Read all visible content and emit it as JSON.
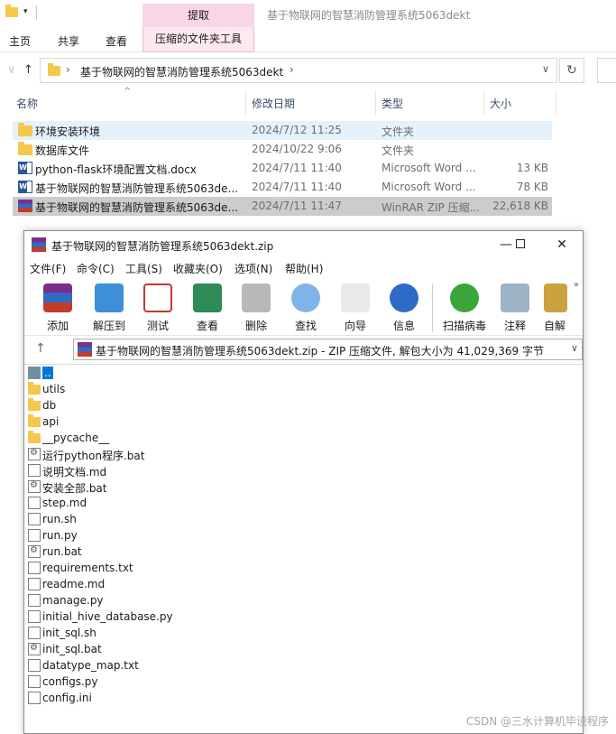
{
  "explorer": {
    "quick_access_dropdown": "▾",
    "extract_tab": "提取",
    "window_title": "基于物联网的智慧消防管理系统5063dekt",
    "ribbon_tabs": [
      "主页",
      "共享",
      "查看"
    ],
    "ribbon_tool_tab": "压缩的文件夹工具",
    "nav_back": "←",
    "nav_forward": "→",
    "nav_recent": "∨",
    "nav_up": "↑",
    "address": "基于物联网的智慧消防管理系统5063dekt",
    "columns": [
      "名称",
      "修改日期",
      "类型",
      "大小"
    ],
    "files": [
      {
        "name": "环境安装环境",
        "date": "2024/7/12 11:25",
        "type": "文件夹",
        "size": ""
      },
      {
        "name": "数据库文件",
        "date": "2024/10/22 9:06",
        "type": "文件夹",
        "size": ""
      },
      {
        "name": "python-flask环境配置文档.docx",
        "date": "2024/7/11 11:40",
        "type": "Microsoft Word ...",
        "size": "13 KB"
      },
      {
        "name": "基于物联网的智慧消防管理系统5063de...",
        "date": "2024/7/11 11:40",
        "type": "Microsoft Word ...",
        "size": "78 KB"
      },
      {
        "name": "基于物联网的智慧消防管理系统5063de...",
        "date": "2024/7/11 11:47",
        "type": "WinRAR ZIP 压缩...",
        "size": "22,618 KB"
      }
    ]
  },
  "winrar": {
    "title": "基于物联网的智慧消防管理系统5063dekt.zip",
    "menu": [
      "文件(F)",
      "命令(C)",
      "工具(S)",
      "收藏夹(O)",
      "选项(N)",
      "帮助(H)"
    ],
    "toolbar": [
      {
        "label": "添加",
        "icon": "add-archive-icon",
        "color": "#c0392b"
      },
      {
        "label": "解压到",
        "icon": "extract-folder-icon",
        "color": "#3d8fd8"
      },
      {
        "label": "测试",
        "icon": "test-clipboard-icon",
        "color": "#c0392b"
      },
      {
        "label": "查看",
        "icon": "view-book-icon",
        "color": "#2e8b57"
      },
      {
        "label": "删除",
        "icon": "delete-bin-icon",
        "color": "#8c8c8c"
      },
      {
        "label": "查找",
        "icon": "find-magnifier-icon",
        "color": "#3d7fc8"
      },
      {
        "label": "向导",
        "icon": "wizard-wand-icon",
        "color": "#7a7a7a"
      },
      {
        "label": "信息",
        "icon": "info-icon",
        "color": "#2e6bc6"
      },
      {
        "label": "扫描病毒",
        "icon": "virus-scan-icon",
        "color": "#3aa63a"
      },
      {
        "label": "注释",
        "icon": "comment-icon",
        "color": "#7a95b0"
      },
      {
        "label": "自解",
        "icon": "sfx-box-icon",
        "color": "#c9a23d"
      }
    ],
    "toolbar_more": "»",
    "path_up": "↑",
    "path_text": "基于物联网的智慧消防管理系统5063dekt.zip - ZIP 压缩文件, 解包大小为 41,029,369 字节",
    "path_dropdown": "∨",
    "items": [
      {
        "name": "..",
        "kind": "up"
      },
      {
        "name": "utils",
        "kind": "folder"
      },
      {
        "name": "db",
        "kind": "folder"
      },
      {
        "name": "api",
        "kind": "folder"
      },
      {
        "name": "__pycache__",
        "kind": "folder"
      },
      {
        "name": "运行python程序.bat",
        "kind": "bat"
      },
      {
        "name": "说明文档.md",
        "kind": "file"
      },
      {
        "name": "安装全部.bat",
        "kind": "bat"
      },
      {
        "name": "step.md",
        "kind": "file"
      },
      {
        "name": "run.sh",
        "kind": "file"
      },
      {
        "name": "run.py",
        "kind": "file"
      },
      {
        "name": "run.bat",
        "kind": "bat"
      },
      {
        "name": "requirements.txt",
        "kind": "file"
      },
      {
        "name": "readme.md",
        "kind": "file"
      },
      {
        "name": "manage.py",
        "kind": "file"
      },
      {
        "name": "initial_hive_database.py",
        "kind": "file"
      },
      {
        "name": "init_sql.sh",
        "kind": "file"
      },
      {
        "name": "init_sql.bat",
        "kind": "bat"
      },
      {
        "name": "datatype_map.txt",
        "kind": "file"
      },
      {
        "name": "configs.py",
        "kind": "file"
      },
      {
        "name": "config.ini",
        "kind": "file"
      }
    ]
  },
  "watermark": "CSDN @三水计算机毕设程序"
}
